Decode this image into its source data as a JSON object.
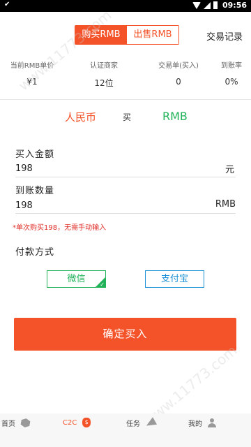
{
  "status_bar": {
    "time": "09:56"
  },
  "header": {
    "tabs": [
      {
        "label": "购买RMB",
        "active": true
      },
      {
        "label": "出售RMB",
        "active": false
      }
    ],
    "records_link": "交易记录"
  },
  "stats": [
    {
      "label": "当前RMB单价",
      "value": "¥1"
    },
    {
      "label": "认证商家",
      "value": "12位"
    },
    {
      "label": "交易单(买入)",
      "value": "0"
    },
    {
      "label": "到账率",
      "value": "0%"
    }
  ],
  "currency": {
    "left": "人民币",
    "middle": "买",
    "right": "RMB"
  },
  "buy_amount": {
    "label": "买入金额",
    "value": "198",
    "unit": "元"
  },
  "receive_amount": {
    "label": "到账数量",
    "value": "198",
    "unit": "RMB"
  },
  "hint": "*单次购买198，无需手动输入",
  "payment": {
    "label": "付款方式",
    "options": [
      {
        "label": "微信",
        "selected": true
      },
      {
        "label": "支付宝",
        "selected": false
      }
    ]
  },
  "confirm_button": "确定买入",
  "bottom_nav": [
    {
      "label": "首页",
      "icon": "box-icon",
      "active": false
    },
    {
      "label": "C2C",
      "icon": "money-bag-icon",
      "active": true
    },
    {
      "label": "任务",
      "icon": "paper-plane-icon",
      "active": false
    },
    {
      "label": "我的",
      "icon": "user-icon",
      "active": false
    }
  ],
  "watermark": "www.11773.com",
  "colors": {
    "accent": "#f4532a",
    "green": "#22b35a",
    "blue": "#1e90d6",
    "hint_red": "#e0302a"
  }
}
